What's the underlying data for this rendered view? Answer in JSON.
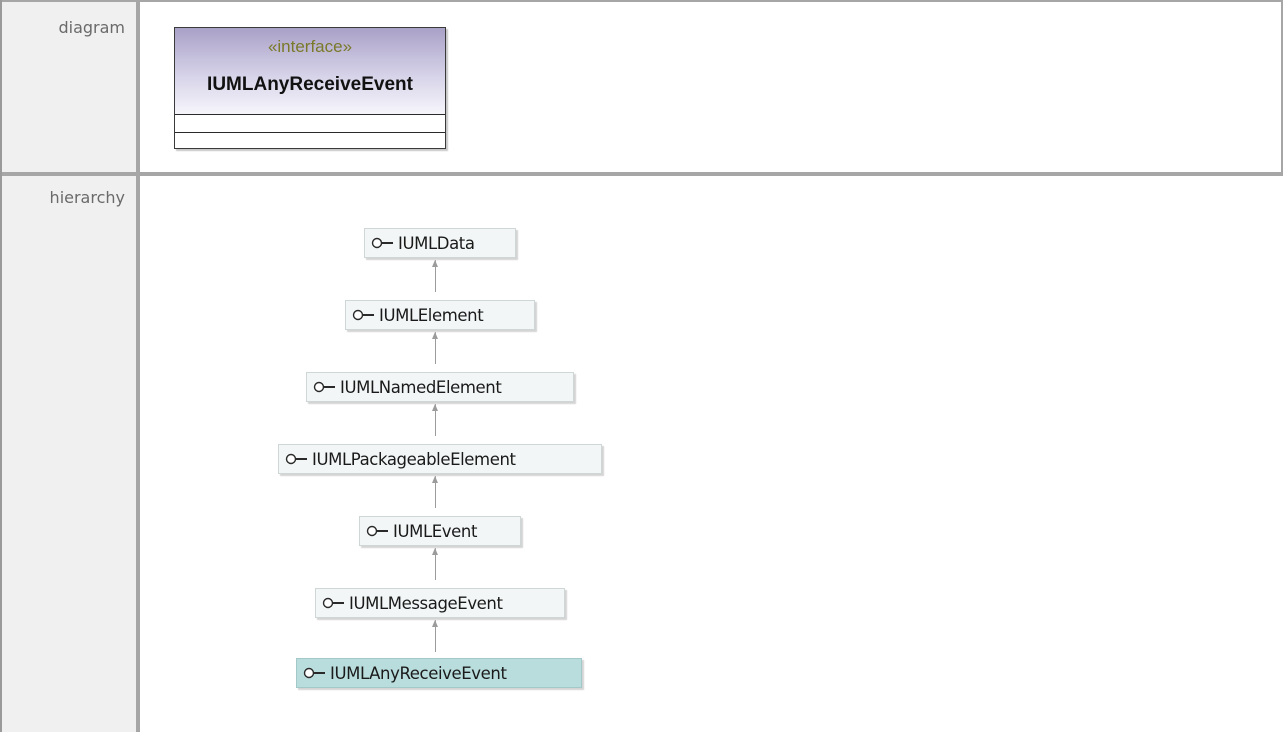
{
  "rows": {
    "diagram_label": "diagram",
    "hierarchy_label": "hierarchy"
  },
  "uml": {
    "stereotype": "«interface»",
    "name": "IUMLAnyReceiveEvent",
    "colors": {
      "header_top": "#a9a1c7",
      "header_bottom": "#f6f5fb",
      "stereotype_text": "#7a7a2a"
    }
  },
  "hierarchy": {
    "icon": "interface-lollipop-icon",
    "nodes": [
      {
        "label": "IUMLData",
        "selected": false
      },
      {
        "label": "IUMLElement",
        "selected": false
      },
      {
        "label": "IUMLNamedElement",
        "selected": false
      },
      {
        "label": "IUMLPackageableElement",
        "selected": false
      },
      {
        "label": "IUMLEvent",
        "selected": false
      },
      {
        "label": "IUMLMessageEvent",
        "selected": false
      },
      {
        "label": "IUMLAnyReceiveEvent",
        "selected": true
      }
    ],
    "colors": {
      "node_bg": "#f2f6f6",
      "selected_bg": "#b9dcdc"
    }
  }
}
